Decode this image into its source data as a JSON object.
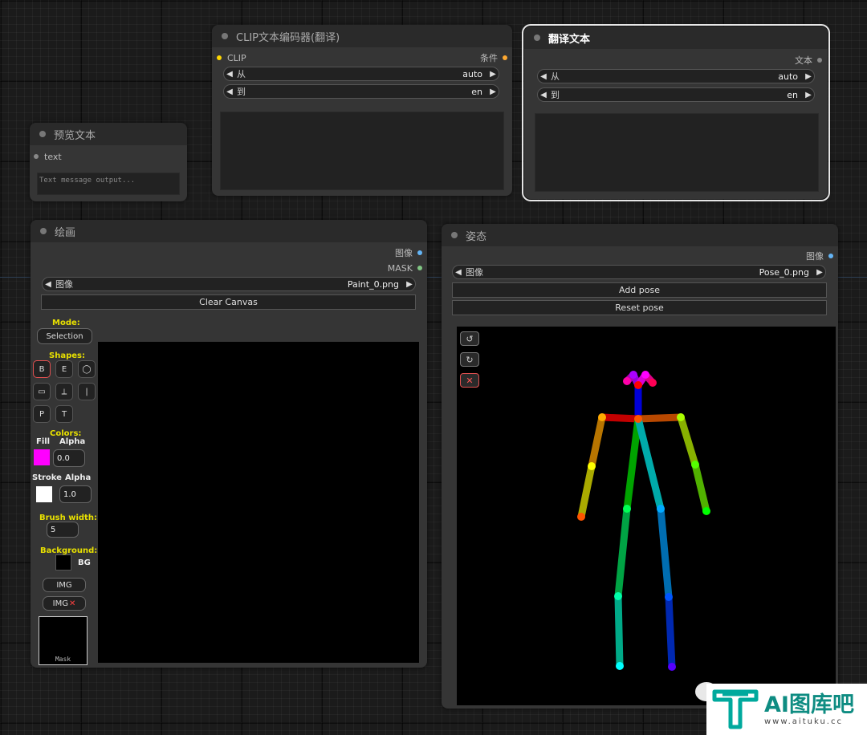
{
  "colors": {
    "clip_slot": "#ffd700",
    "cond_slot": "#ffa931",
    "image_slot": "#64b5f6",
    "mask_slot": "#81c784",
    "fill_color": "#ff00ff",
    "stroke_color": "#ffffff",
    "accent_yellow": "#e8e000",
    "watermark_teal": "#00a99d"
  },
  "preview_node": {
    "title": "预览文本",
    "input_label": "text",
    "placeholder": "Text message output..."
  },
  "clip_node": {
    "title": "CLIP文本编码器(翻译)",
    "input_label": "CLIP",
    "output_label": "条件",
    "from_label": "从",
    "from_value": "auto",
    "to_label": "到",
    "to_value": "en"
  },
  "translate_node": {
    "title": "翻译文本",
    "output_label": "文本",
    "from_label": "从",
    "from_value": "auto",
    "to_label": "到",
    "to_value": "en"
  },
  "paint_node": {
    "title": "绘画",
    "output_image": "图像",
    "output_mask": "MASK",
    "image_label": "图像",
    "image_value": "Paint_0.png",
    "clear_label": "Clear Canvas",
    "mode_label": "Mode:",
    "mode_value": "Selection",
    "shapes_label": "Shapes:",
    "shape_buttons": [
      "B",
      "E",
      "◯",
      "▭",
      "⟂",
      "|",
      "P",
      "T"
    ],
    "colors_label": "Colors:",
    "fill_label": "Fill",
    "alpha_label": "Alpha",
    "fill_alpha": "0.0",
    "stroke_label": "Stroke",
    "stroke_alpha": "1.0",
    "brush_label": "Brush width:",
    "brush_value": "5",
    "background_label": "Background:",
    "bg_label": "BG",
    "img_label": "IMG",
    "img_remove_label": "IMG",
    "mask_label": "Mask"
  },
  "pose_node": {
    "title": "姿态",
    "output_image": "图像",
    "image_label": "图像",
    "image_value": "Pose_0.png",
    "add_pose": "Add pose",
    "reset_pose": "Reset pose"
  },
  "watermark": {
    "brand": "AI图库吧",
    "url": "www.aituku.cc"
  }
}
